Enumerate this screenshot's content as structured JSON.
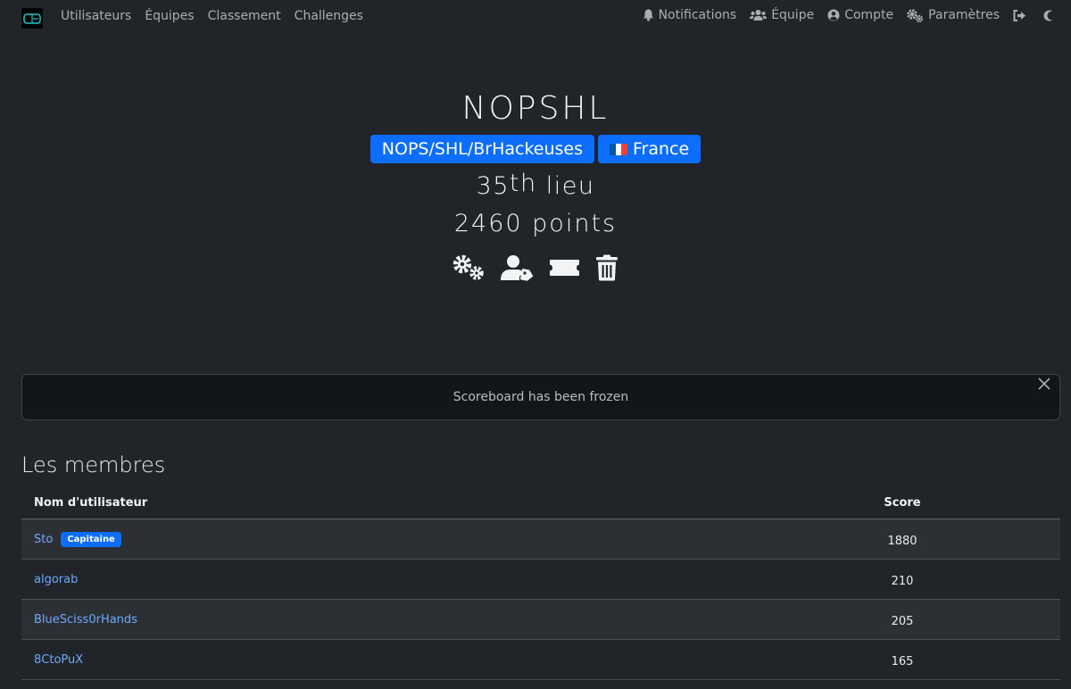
{
  "nav": {
    "left": [
      "Utilisateurs",
      "Équipes",
      "Classement",
      "Challenges"
    ],
    "notifications": "Notifications",
    "team": "Équipe",
    "account": "Compte",
    "settings": "Paramètres"
  },
  "team": {
    "name": "NOPSHL",
    "affiliation": "NOPS/SHL/BrHackeuses",
    "country": "France",
    "place_num": "35",
    "place_suffix": "th",
    "place_word": "lieu",
    "points": "2460 points"
  },
  "alert": {
    "text": "Scoreboard has been frozen"
  },
  "members": {
    "title": "Les membres",
    "col_name": "Nom d'utilisateur",
    "col_score": "Score",
    "captain_label": "Capitaine",
    "rows": [
      {
        "name": "Sto",
        "score": "1880"
      },
      {
        "name": "algorab",
        "score": "210"
      },
      {
        "name": "BlueSciss0rHands",
        "score": "205"
      },
      {
        "name": "8CtoPuX",
        "score": "165"
      }
    ]
  },
  "colors": {
    "accent": "#0d6efd",
    "link": "#6ea8fe",
    "background": "#212529"
  }
}
